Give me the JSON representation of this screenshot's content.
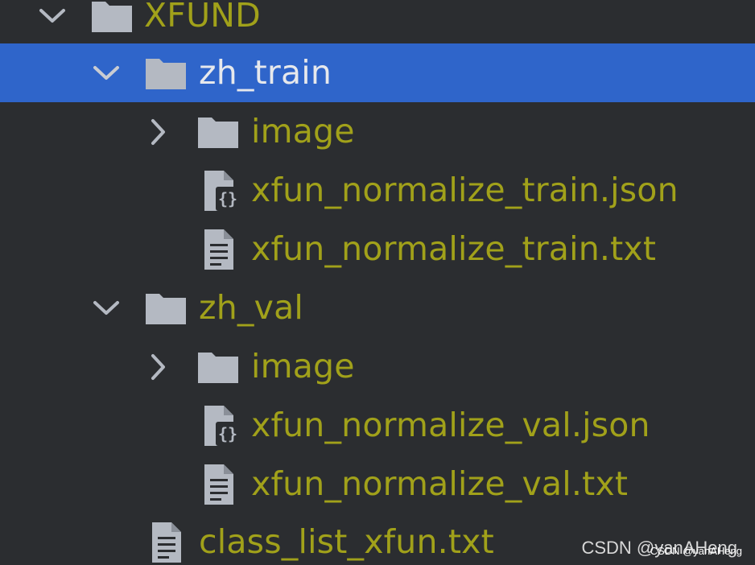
{
  "tree": {
    "root": {
      "label": "XFUND",
      "expanded": true
    },
    "zh_train": {
      "label": "zh_train",
      "expanded": true,
      "selected": true,
      "children": {
        "image": {
          "label": "image",
          "expanded": false
        },
        "json": {
          "label": "xfun_normalize_train.json",
          "icon": "json-file-icon"
        },
        "txt": {
          "label": "xfun_normalize_train.txt",
          "icon": "text-file-icon"
        }
      }
    },
    "zh_val": {
      "label": "zh_val",
      "expanded": true,
      "children": {
        "image": {
          "label": "image",
          "expanded": false
        },
        "json": {
          "label": "xfun_normalize_val.json",
          "icon": "json-file-icon"
        },
        "txt": {
          "label": "xfun_normalize_val.txt",
          "icon": "text-file-icon"
        }
      }
    },
    "class_list": {
      "label": "class_list_xfun.txt",
      "icon": "text-file-icon"
    }
  },
  "watermark": {
    "main": "CSDN @yanAHeng",
    "small": "CSDN @yanAHeng"
  },
  "colors": {
    "background": "#2b2d30",
    "selection": "#2f65ca",
    "label_text": "#a1a11a",
    "icon": "#b4b9c2"
  }
}
